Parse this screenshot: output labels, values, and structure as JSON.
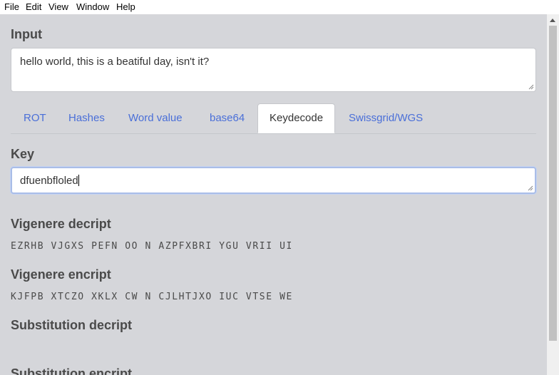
{
  "menu": {
    "file": "File",
    "edit": "Edit",
    "view": "View",
    "window": "Window",
    "help": "Help"
  },
  "input": {
    "title": "Input",
    "value": "hello world, this is a beatiful day, isn't it?"
  },
  "tabs": [
    {
      "label": "ROT"
    },
    {
      "label": "Hashes"
    },
    {
      "label": "Word value"
    },
    {
      "label": "base64"
    },
    {
      "label": "Keydecode"
    },
    {
      "label": "Swissgrid/WGS"
    }
  ],
  "active_tab": "Keydecode",
  "key": {
    "title": "Key",
    "value": "dfuenbfloled"
  },
  "vigenere_decrypt": {
    "title": "Vigenere decript",
    "value": "EZRHB VJGXS PEFN OO N AZPFXBRI YGU VRII UI"
  },
  "vigenere_encrypt": {
    "title": "Vigenere encript",
    "value": "KJFPB XTCZO XKLX CW N CJLHTJXO IUC VTSE WE"
  },
  "substitution_decrypt": {
    "title": "Substitution decript",
    "value": ""
  },
  "substitution_encrypt": {
    "title": "Substitution encript"
  }
}
